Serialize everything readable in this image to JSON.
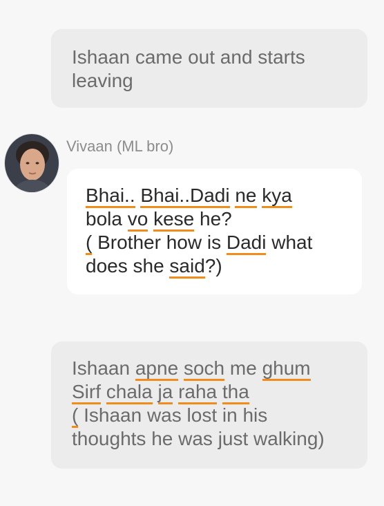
{
  "narration_1": {
    "lines": [
      "Ishaan came out and starts",
      "leaving"
    ]
  },
  "message": {
    "sender": "Vivaan (ML bro)",
    "avatar_icon": "person-avatar-icon",
    "text": {
      "l1": {
        "w1": "Bhai..",
        "w2": "Bhai..Dadi",
        "w3": "ne",
        "w4": "kya"
      },
      "l2": {
        "w1": "bola",
        "w2": "vo",
        "w3": "kese",
        "w4": "he?"
      },
      "l3": {
        "w1": "(",
        "w2": "Brother how is",
        "w3": "Dadi",
        "w4": "what"
      },
      "l4": {
        "w1": "does she",
        "w2": "said",
        "w3": "?)"
      }
    }
  },
  "narration_2": {
    "l1": {
      "w1": "Ishaan",
      "w2": "apne",
      "w3": "soch",
      "w4": "me",
      "w5": "ghum"
    },
    "l2": {
      "w1": "Sirf",
      "w2": "chala",
      "w3": "ja",
      "w4": "raha",
      "w5": "tha"
    },
    "l3": {
      "w1": "(",
      "w2": "Ishaan was lost in his"
    },
    "l4": {
      "w1": "thoughts he was just walking)"
    }
  },
  "colors": {
    "spellcheck_underline": "#f08c1c",
    "narration_bg": "#ececec",
    "bubble_bg": "#ffffff",
    "page_bg": "#f7f7f7"
  }
}
